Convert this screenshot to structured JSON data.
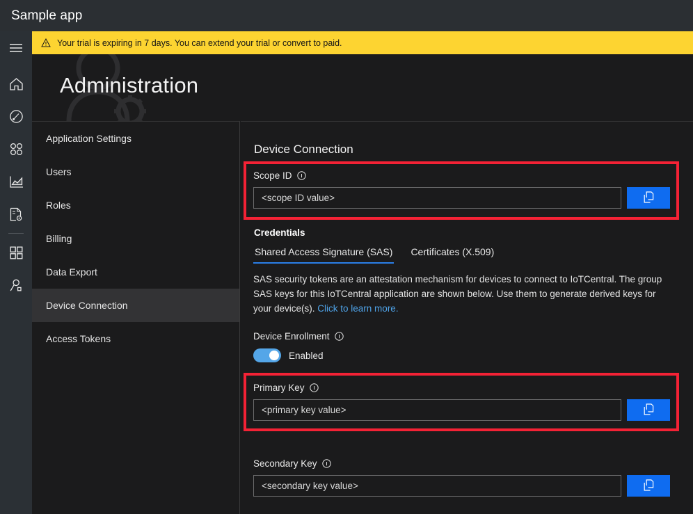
{
  "titlebar": {
    "app_name": "Sample app"
  },
  "banner": {
    "icon": "warning-triangle-icon",
    "text": "Your trial is expiring in 7 days. You can extend your trial or convert to paid."
  },
  "page": {
    "title": "Administration",
    "watermark_icon": "person-with-gear-icon"
  },
  "rail": {
    "items": [
      {
        "icon": "hamburger-menu-icon",
        "name": "menu"
      },
      {
        "icon": "home-icon",
        "name": "home"
      },
      {
        "icon": "compass-icon",
        "name": "device-templates"
      },
      {
        "icon": "device-groups-icon",
        "name": "device-groups"
      },
      {
        "icon": "analytics-chart-icon",
        "name": "analytics"
      },
      {
        "icon": "jobs-document-gear-icon",
        "name": "jobs"
      },
      {
        "icon": "dashboard-grid-icon",
        "name": "dashboards"
      },
      {
        "icon": "user-search-icon",
        "name": "administration"
      }
    ]
  },
  "nav": {
    "items": [
      {
        "label": "Application Settings",
        "selected": false
      },
      {
        "label": "Users",
        "selected": false
      },
      {
        "label": "Roles",
        "selected": false
      },
      {
        "label": "Billing",
        "selected": false
      },
      {
        "label": "Data Export",
        "selected": false
      },
      {
        "label": "Device Connection",
        "selected": true
      },
      {
        "label": "Access Tokens",
        "selected": false
      }
    ]
  },
  "content": {
    "heading": "Device Connection",
    "scope_id": {
      "label": "Scope ID",
      "info_icon": "info-circle-icon",
      "value": "<scope ID value>",
      "copy_icon": "copy-documents-icon"
    },
    "credentials": {
      "heading": "Credentials",
      "tabs": [
        {
          "label": "Shared Access Signature (SAS)",
          "active": true
        },
        {
          "label": "Certificates (X.509)",
          "active": false
        }
      ],
      "description": "SAS security tokens are an attestation mechanism for devices to connect to IoTCentral. The group SAS keys for this IoTCentral application are shown below. Use them to generate derived keys for your device(s). ",
      "link_text": "Click to learn more."
    },
    "device_enrollment": {
      "label": "Device Enrollment",
      "info_icon": "info-circle-icon",
      "toggle_state": "Enabled",
      "toggle_on": true
    },
    "primary_key": {
      "label": "Primary Key",
      "info_icon": "info-circle-icon",
      "value": "<primary key value>",
      "copy_icon": "copy-documents-icon"
    },
    "secondary_key": {
      "label": "Secondary Key",
      "info_icon": "info-circle-icon",
      "value": "<secondary key value>",
      "copy_icon": "copy-documents-icon"
    }
  },
  "colors": {
    "banner_yellow": "#fdd431",
    "accent_blue": "#0f6cf0",
    "tab_underline": "#2a7fe8",
    "highlight_red": "#f42235",
    "link_blue": "#4fa3e8",
    "toggle_blue": "#54a6e8"
  },
  "annotations": {
    "highlight_boxes": [
      "scope-id-field",
      "primary-key-field"
    ]
  }
}
